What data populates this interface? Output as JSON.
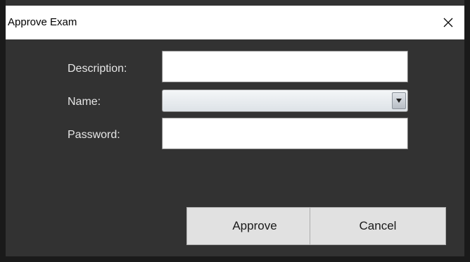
{
  "dialog": {
    "title": "Approve Exam",
    "close_icon": "close-icon"
  },
  "form": {
    "description": {
      "label": "Description:",
      "value": ""
    },
    "name": {
      "label": "Name:",
      "selected": "",
      "arrow_icon": "dropdown-arrow-icon"
    },
    "password": {
      "label": "Password:",
      "value": ""
    }
  },
  "buttons": {
    "approve": "Approve",
    "cancel": "Cancel"
  },
  "colors": {
    "dialog_background": "#323232",
    "titlebar_background": "#ffffff",
    "button_background": "#e1e1e1",
    "label_text": "#e6e6e6"
  }
}
